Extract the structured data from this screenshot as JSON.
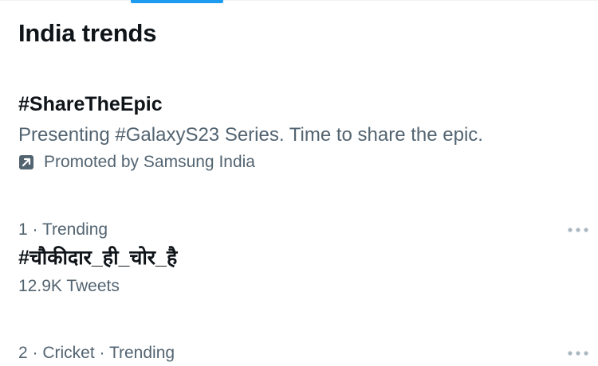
{
  "header": {
    "title": "India trends"
  },
  "promoted": {
    "hashtag": "#ShareTheEpic",
    "description": "Presenting #GalaxyS23 Series. Time to share the epic.",
    "byline": "Promoted by Samsung India",
    "icon": "promoted-arrow-icon"
  },
  "trends": [
    {
      "meta": "1 · Trending",
      "name": "#चौकीदार_ही_चोर_है",
      "count": "12.9K Tweets"
    },
    {
      "meta": "2 · Cricket · Trending"
    }
  ],
  "icons": {
    "more": "more-horizontal-icon"
  },
  "colors": {
    "accent": "#1d9bf0",
    "text_primary": "#0f1419",
    "text_secondary": "#536471",
    "icon_muted": "#aab8c2"
  }
}
